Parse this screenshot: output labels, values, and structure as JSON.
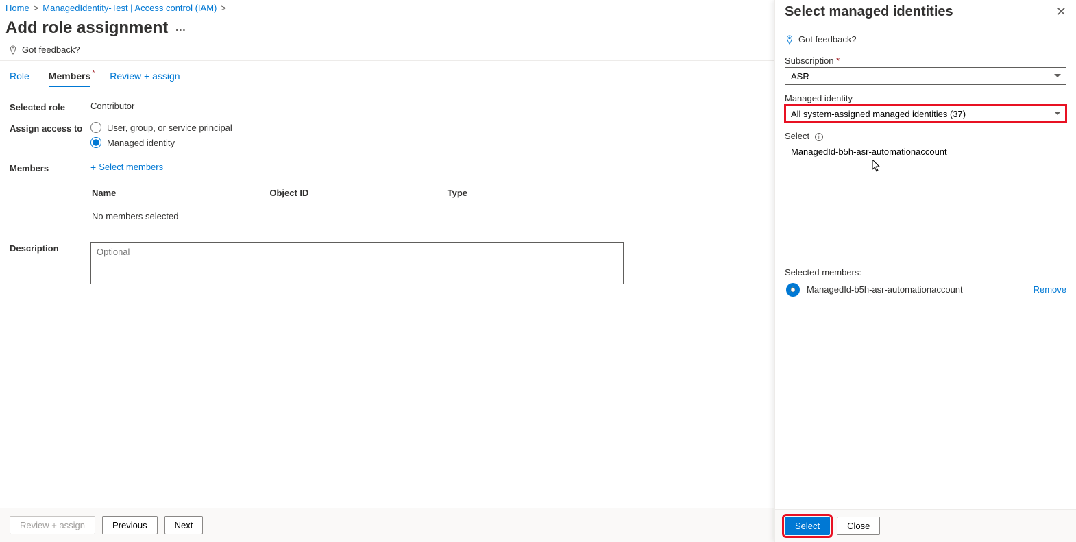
{
  "breadcrumb": {
    "home": "Home",
    "item": "ManagedIdentity-Test | Access control (IAM)"
  },
  "page": {
    "title": "Add role assignment",
    "dots": "…"
  },
  "toolbar": {
    "feedback": "Got feedback?"
  },
  "tabs": {
    "role": "Role",
    "members": "Members",
    "review": "Review + assign"
  },
  "form": {
    "selected_role_label": "Selected role",
    "selected_role_value": "Contributor",
    "assign_access_label": "Assign access to",
    "radio_user": "User, group, or service principal",
    "radio_mi": "Managed identity",
    "members_label": "Members",
    "select_members": "Select members",
    "table": {
      "name": "Name",
      "object_id": "Object ID",
      "type": "Type",
      "no_members": "No members selected"
    },
    "description_label": "Description",
    "description_placeholder": "Optional"
  },
  "footer": {
    "review": "Review + assign",
    "previous": "Previous",
    "next": "Next"
  },
  "panel": {
    "title": "Select managed identities",
    "feedback": "Got feedback?",
    "subscription_label": "Subscription",
    "subscription_value": "ASR",
    "managed_identity_label": "Managed identity",
    "managed_identity_value": "All system-assigned managed identities (37)",
    "select_label": "Select",
    "select_value": "ManagedId-b5h-asr-automationaccount",
    "selected_members_label": "Selected members:",
    "selected_member_name": "ManagedId-b5h-asr-automationaccount",
    "remove": "Remove",
    "select_btn": "Select",
    "close_btn": "Close"
  }
}
